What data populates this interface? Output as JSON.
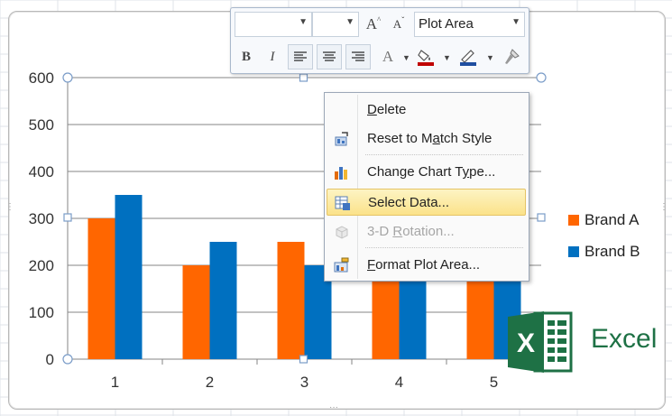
{
  "chart_data": {
    "type": "bar",
    "categories": [
      "1",
      "2",
      "3",
      "4",
      "5"
    ],
    "series": [
      {
        "name": "Brand A",
        "values": [
          300,
          200,
          250,
          200,
          200
        ],
        "color": "#ff6600"
      },
      {
        "name": "Brand B",
        "values": [
          350,
          250,
          200,
          200,
          200
        ],
        "color": "#0070c0"
      }
    ],
    "y_ticks": [
      "0",
      "100",
      "200",
      "300",
      "400",
      "500",
      "600"
    ],
    "ylim": [
      0,
      600
    ],
    "grid": true,
    "legend_position": "right"
  },
  "legend": {
    "items": [
      {
        "label": "Brand A",
        "color": "#ff6600"
      },
      {
        "label": "Brand B",
        "color": "#0070c0"
      }
    ]
  },
  "mini_toolbar": {
    "font_name": "",
    "font_size": "",
    "grow_font_label": "A",
    "shrink_font_label": "A",
    "element_select": "Plot Area",
    "bold_label": "B",
    "italic_label": "I",
    "font_color_label": "A",
    "icons": [
      "align-left-icon",
      "align-center-icon",
      "align-right-icon",
      "fill-color-icon",
      "line-color-icon",
      "format-painter-icon"
    ],
    "fill_color": "#c00000",
    "line_color": "#1f4ea0"
  },
  "context_menu": {
    "items": [
      {
        "label_pre": "",
        "label_ul": "D",
        "label_post": "elete",
        "icon": "",
        "disabled": false,
        "selected": false
      },
      {
        "label_pre": "Reset to M",
        "label_ul": "a",
        "label_post": "tch Style",
        "icon": "reset-style-icon",
        "disabled": false,
        "selected": false
      },
      {
        "label_pre": "Change Chart T",
        "label_ul": "y",
        "label_post": "pe...",
        "icon": "chart-type-icon",
        "disabled": false,
        "selected": false
      },
      {
        "label_pre": "Select Data...",
        "label_ul": "",
        "label_post": "",
        "icon": "select-data-icon",
        "disabled": false,
        "selected": true
      },
      {
        "label_pre": "3-D ",
        "label_ul": "R",
        "label_post": "otation...",
        "icon": "rotation-icon",
        "disabled": true,
        "selected": false
      },
      {
        "label_pre": "",
        "label_ul": "F",
        "label_post": "ormat Plot Area...",
        "icon": "format-area-icon",
        "disabled": false,
        "selected": false
      }
    ]
  },
  "logo": {
    "letter": "X",
    "word": "Excel",
    "color": "#1e7145"
  }
}
